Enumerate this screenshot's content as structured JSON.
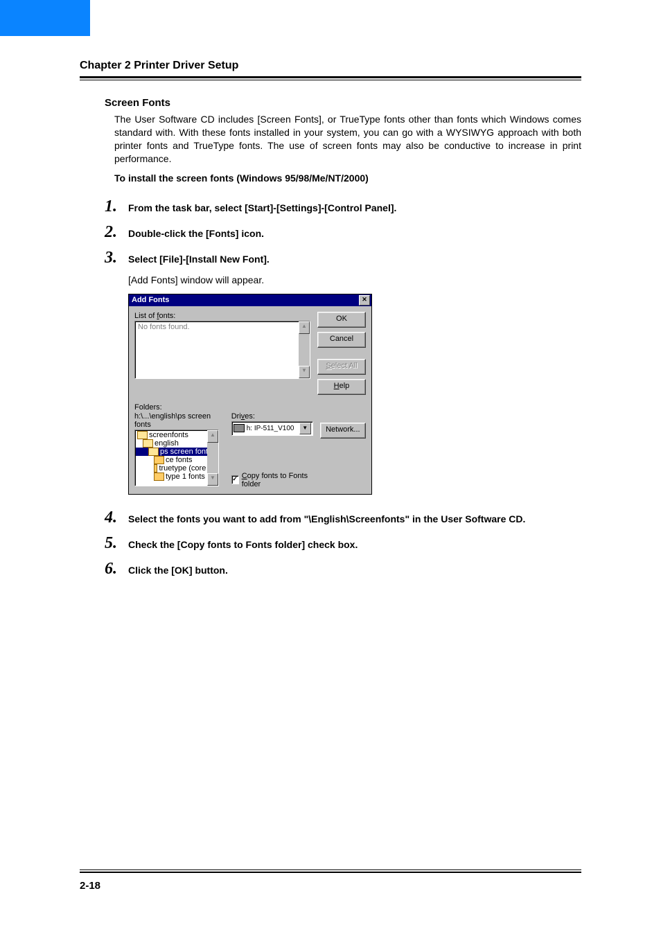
{
  "chapter_title": "Chapter 2 Printer Driver Setup",
  "section_title": "Screen Fonts",
  "intro_text": "The User Software CD includes [Screen Fonts], or TrueType fonts other than fonts which Windows comes standard with. With these fonts installed in your system, you can go with a WYSIWYG approach with both printer fonts and TrueType fonts. The use of screen fonts may also be conductive to increase in print performance.",
  "install_heading": "To install the screen fonts (Windows 95/98/Me/NT/2000)",
  "steps": {
    "n1": "1.",
    "t1": "From the task bar, select [Start]-[Settings]-[Control Panel].",
    "n2": "2.",
    "t2": "Double-click the [Fonts] icon.",
    "n3": "3.",
    "t3": "Select [File]-[Install New Font].",
    "note3": "[Add Fonts] window will appear.",
    "n4": "4.",
    "t4": "Select the fonts you want to add from \"\\English\\Screenfonts\" in the User Software CD.",
    "n5": "5.",
    "t5": "Check the [Copy fonts to Fonts folder] check box.",
    "n6": "6.",
    "t6": "Click the [OK] button."
  },
  "dialog": {
    "title": "Add Fonts",
    "list_label_pre": "List of ",
    "list_label_u": "f",
    "list_label_post": "onts:",
    "list_empty": "No fonts found.",
    "btn_ok": "OK",
    "btn_cancel": "Cancel",
    "btn_select_pre": "",
    "btn_select_u": "S",
    "btn_select_post": "elect All",
    "btn_help_pre": "",
    "btn_help_u": "H",
    "btn_help_post": "elp",
    "btn_network": "Network...",
    "folders_label": "Folders:",
    "folders_path": "h:\\...\\english\\ps screen fonts",
    "drives_label_pre": "Dri",
    "drives_label_u": "v",
    "drives_label_post": "es:",
    "drive_value": "h: IP-511_V100",
    "copy_label_pre": "",
    "copy_label_u": "C",
    "copy_label_post": "opy fonts to Fonts folder",
    "tree": {
      "r1": "screenfonts",
      "r2": "english",
      "r3": "ps screen fonts",
      "r4": "ce fonts",
      "r5": "truetype (core os",
      "r6": "type 1 fonts"
    }
  },
  "page_number": "2-18"
}
